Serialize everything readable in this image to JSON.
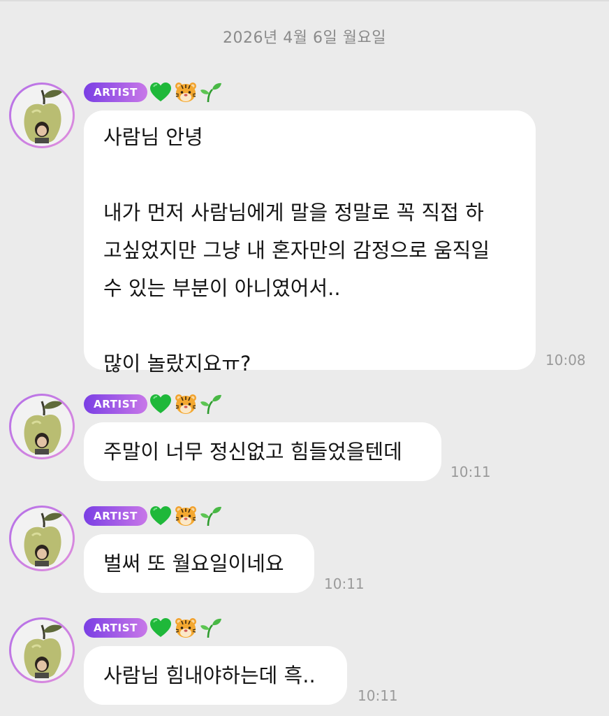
{
  "date_header": "2026년 4월 6일 월요일",
  "badge_label": "ARTIST",
  "name_emojis": [
    "green-heart",
    "tiger-face",
    "seedling"
  ],
  "messages": [
    {
      "lines": [
        "사람님 안녕",
        "",
        "내가 먼저 사람님에게 말을 정말로 꼭 직접 하",
        "고싶었지만 그냥 내 혼자만의 감정으로 움직일",
        "수 있는 부분이 아니였어서..",
        "",
        "많이 놀랐지요ㅠ?"
      ],
      "time": "10:08"
    },
    {
      "lines": [
        "주말이 너무 정신없고 힘들었을텐데"
      ],
      "time": "10:11"
    },
    {
      "lines": [
        "벌써 또 월요일이네요"
      ],
      "time": "10:11"
    },
    {
      "lines": [
        "사람님 힘내야하는데 흑.."
      ],
      "time": "10:11"
    }
  ]
}
